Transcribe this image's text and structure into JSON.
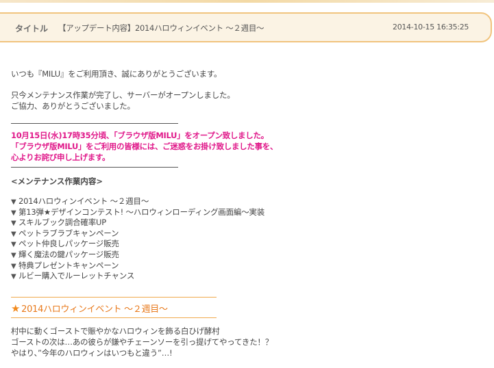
{
  "header": {
    "label": "タイトル",
    "title": "【アップデート内容】2014ハロウィンイベント ～２週目～",
    "date": "2014-10-15 16:35:25"
  },
  "intro": {
    "line1": "いつも『MILU』をご利用頂き、誠にありがとうございます。",
    "line2": "只今メンテナンス作業が完了し、サーバーがオープンしました。",
    "line3": "ご協力、ありがとうございました。"
  },
  "notice": {
    "line1": "10月15日(水)17時35分頃、「ブラウザ版MILU」をオープン致しました。",
    "line2": "「ブラウザ版MILU」をご利用の皆様には、ご迷惑をお掛け致しました事を、",
    "line3": "心よりお詫び申し上げます。"
  },
  "maintenance": {
    "heading": "<メンテナンス作業内容>",
    "bullet": "▼",
    "items": [
      "2014ハロウィンイベント ～２週目～",
      "第13弾★デザインコンテスト! ～ハロウィンローディング画面編～実装",
      "スキルブック調合確率UP",
      "ペットラブラブキャンペーン",
      "ペット仲良しパッケージ販売",
      "輝く魔法の鍵パッケージ販売",
      "特典プレゼントキャンペーン",
      "ルビー購入でルーレットチャンス"
    ]
  },
  "event": {
    "star": "★",
    "heading": "2014ハロウィンイベント ～２週目～",
    "line1": "村中に動くゴーストで賑やかなハロウィンを飾る白ひげ酵村",
    "line2": "ゴーストの次は…あの彼らが鎌やチェーンソーを引っ提げてやってきた！？",
    "line3": "やはり、”今年のハロウィンはいつもと違う”…!"
  }
}
